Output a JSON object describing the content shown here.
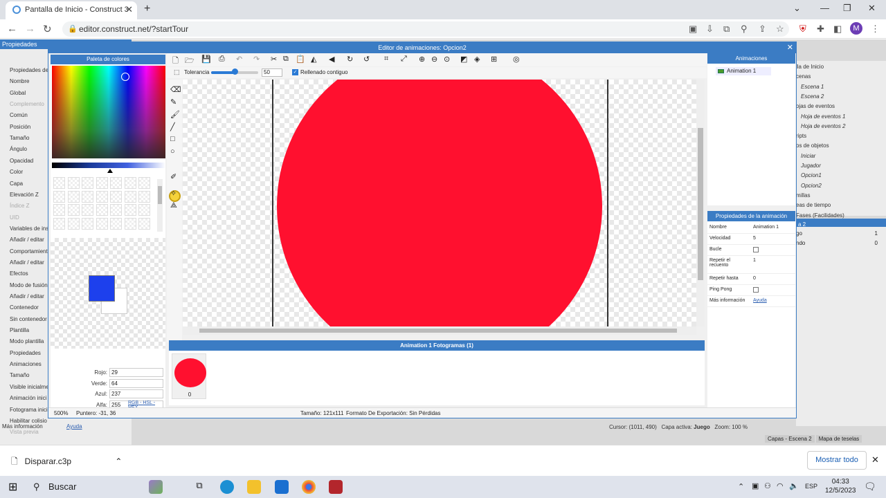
{
  "browser": {
    "tab_title": "Pantalla de Inicio - Construct 3",
    "url": "editor.construct.net/?startTour",
    "profile_initial": "M"
  },
  "construct": {
    "properties_header": "Propiedades",
    "properties": [
      "Propiedades de",
      "Nombre",
      "Global",
      "Complemento",
      "Común",
      "Posición",
      "Tamaño",
      "Ángulo",
      "Opacidad",
      "Color",
      "Capa",
      "Elevación Z",
      "Índice Z",
      "UID",
      "Variables de ins",
      "Añadir / editar",
      "Comportamient",
      "Añadir / editar",
      "Efectos",
      "Modo de fusión",
      "Añadir / editar",
      "Contenedor",
      "Sin contenedor",
      "Plantilla",
      "Modo plantilla",
      "Propiedades",
      "Animaciones",
      "Tamaño",
      "Visible inicialme",
      "Animación inici",
      "Fotograma inici",
      "Habilitar colisio",
      "Vista previa"
    ],
    "more_info_label": "Más información",
    "more_info_link": "Ayuda",
    "project_items": [
      "lla de Inicio",
      "cenas",
      "Escena 1",
      "Escena 2",
      "ojas de eventos",
      "Hoja de eventos 1",
      "Hoja de eventos 2",
      "ripts",
      "os de objetos",
      "Iniciar",
      "Jugador",
      "Opcion1",
      "Opcion2",
      "millas",
      "eas de tiempo",
      "Fases (Facilidades)"
    ],
    "layers_header": "a 2",
    "layers": [
      {
        "name": "go",
        "value": "1"
      },
      {
        "name": "ndo",
        "value": "0"
      }
    ],
    "status": {
      "cursor": "Cursor: (1011, 490)",
      "layer_label": "Capa activa:",
      "layer_value": "Juego",
      "zoom": "Zoom: 100 %"
    },
    "bottom_tabs": [
      "Capas - Escena 2",
      "Mapa de teselas"
    ]
  },
  "dialog": {
    "title": "Editor de animaciones: Opcion2",
    "palette_header": "Paleta de colores",
    "tolerance_label": "Tolerancia",
    "tolerance_value": "50",
    "tolerance_fraction": 0.5,
    "contiguous_label": "Rellenado contiguo",
    "channels": [
      {
        "label": "Rojo:",
        "value": "29"
      },
      {
        "label": "Verde:",
        "value": "64"
      },
      {
        "label": "Azul:",
        "value": "237"
      },
      {
        "label": "Alfa:",
        "value": "255"
      }
    ],
    "formats": {
      "rgb": "RGB",
      "hsl": "HSL",
      "hex": "HEX",
      "sep": " - "
    },
    "foreground_color": "#1d40ed",
    "fill_color": "#ff102f",
    "frames_header": "Animation 1 Fotogramas (1)",
    "frame_index": "0",
    "status_zoom": "500%",
    "status_pointer": "Puntero: -31, 36",
    "status_size": "Tamaño: 121x111",
    "status_format": "Formato De Exportación: Sin Pérdidas",
    "animations_header": "Animaciones",
    "animation_item": "Animation 1",
    "anim_props_header": "Propiedades de la animación",
    "anim_props": [
      {
        "key": "Nombre",
        "value": "Animation 1",
        "type": "text"
      },
      {
        "key": "Velocidad",
        "value": "5",
        "type": "text"
      },
      {
        "key": "Bucle",
        "value": "",
        "type": "check"
      },
      {
        "key": "Repetir el recuento",
        "value": "1",
        "type": "text"
      },
      {
        "key": "Repetir hasta",
        "value": "0",
        "type": "text"
      },
      {
        "key": "Ping Pong",
        "value": "",
        "type": "check"
      },
      {
        "key": "Más información",
        "value": "Ayuda",
        "type": "link"
      }
    ]
  },
  "download": {
    "file": "Disparar.c3p",
    "show_all": "Mostrar todo"
  },
  "taskbar": {
    "search": "Buscar",
    "time": "04:33",
    "date": "12/5/2023",
    "lang": "ESP"
  }
}
